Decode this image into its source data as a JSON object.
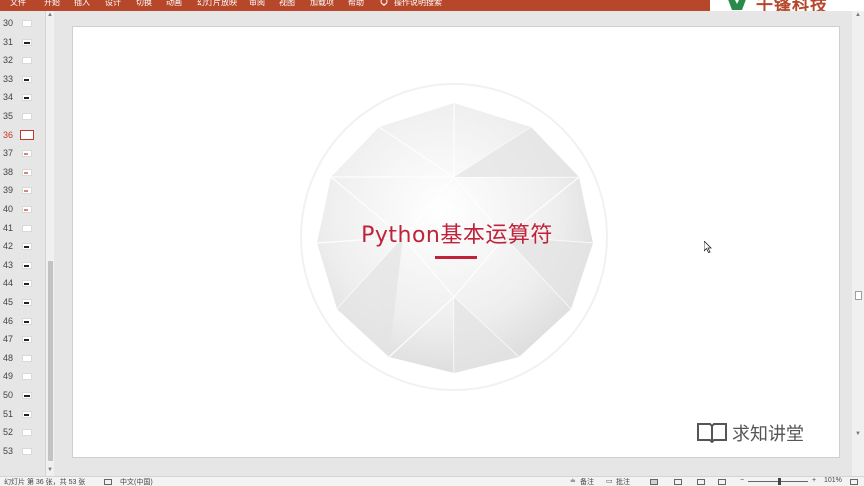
{
  "ribbon": {
    "tabs": [
      "文件",
      "开始",
      "插入",
      "设计",
      "切换",
      "动画",
      "幻灯片放映",
      "审阅",
      "视图",
      "加载项",
      "帮助",
      "操作说明搜索"
    ],
    "brand_text": "千锋科技"
  },
  "thumbnails": {
    "active_number": "36",
    "items": [
      {
        "number": "30"
      },
      {
        "number": "31"
      },
      {
        "number": "32"
      },
      {
        "number": "33"
      },
      {
        "number": "34"
      },
      {
        "number": "35"
      },
      {
        "number": "36"
      },
      {
        "number": "37"
      },
      {
        "number": "38"
      },
      {
        "number": "39"
      },
      {
        "number": "40"
      },
      {
        "number": "41"
      },
      {
        "number": "42"
      },
      {
        "number": "43"
      },
      {
        "number": "44"
      },
      {
        "number": "45"
      },
      {
        "number": "46"
      },
      {
        "number": "47"
      },
      {
        "number": "48"
      },
      {
        "number": "49"
      },
      {
        "number": "50"
      },
      {
        "number": "51"
      },
      {
        "number": "52"
      },
      {
        "number": "53"
      }
    ]
  },
  "slide": {
    "title": "Python基本运算符",
    "accent_color": "#c0223a",
    "watermark_text": "求知讲堂"
  },
  "status": {
    "slide_info": "幻灯片 第 36 张，共 53 张",
    "language": "中文(中国)",
    "notes_label": "备注",
    "comments_label": "批注",
    "zoom": "101%"
  },
  "colors": {
    "ribbon": "#b7472a",
    "active_thumb": "#c0392b"
  }
}
